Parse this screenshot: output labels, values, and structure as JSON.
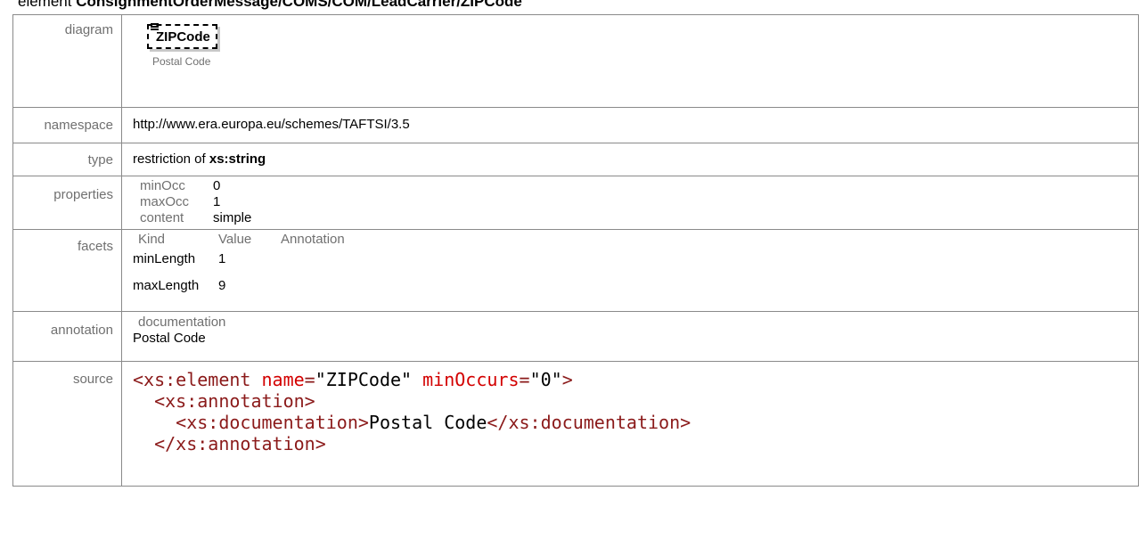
{
  "heading": {
    "prefix": "element",
    "path": "ConsignmentOrderMessage/COMS/COM/LeadCarrier/ZIPCode"
  },
  "labels": {
    "diagram": "diagram",
    "namespace": "namespace",
    "type": "type",
    "properties": "properties",
    "facets": "facets",
    "annotation": "annotation",
    "source": "source"
  },
  "diagram": {
    "element_name": "ZIPCode",
    "subtitle": "Postal Code"
  },
  "namespace": "http://www.era.europa.eu/schemes/TAFTSI/3.5",
  "type": {
    "prefix": "restriction of",
    "base": "xs:string"
  },
  "properties": [
    {
      "key": "minOcc",
      "value": "0"
    },
    {
      "key": "maxOcc",
      "value": "1"
    },
    {
      "key": "content",
      "value": "simple"
    }
  ],
  "facets": {
    "headers": [
      "Kind",
      "Value",
      "Annotation"
    ],
    "rows": [
      {
        "kind": "minLength",
        "value": "1",
        "annotation": ""
      },
      {
        "kind": "maxLength",
        "value": "9",
        "annotation": ""
      }
    ]
  },
  "annotation": {
    "key": "documentation",
    "text": "Postal Code"
  },
  "source": {
    "line1": {
      "open": "<xs:element",
      "attr1": "name",
      "eq1": "=",
      "val1": "\"ZIPCode\"",
      "attr2": "minOccurs",
      "eq2": "=",
      "val2": "\"0\"",
      "close": ">"
    },
    "line2": "<xs:annotation>",
    "line3": {
      "open": "<xs:documentation>",
      "text": "Postal Code",
      "close": "</xs:documentation>"
    },
    "line4": "</xs:annotation>"
  }
}
